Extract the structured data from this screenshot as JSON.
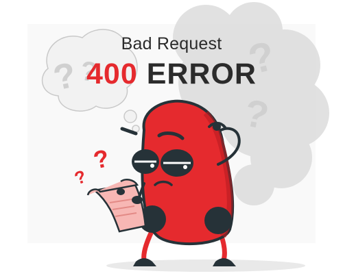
{
  "heading": {
    "subtitle": "Bad Request",
    "code": "400",
    "word": "ERROR"
  },
  "colors": {
    "accent_red": "#e52a2e",
    "dark": "#263238",
    "paper_pink": "#f7b7b4",
    "bubble_gray": "#d9d9d9"
  },
  "illustration": {
    "icon": "confused-character-illustration",
    "bubble_glyph": "?"
  }
}
